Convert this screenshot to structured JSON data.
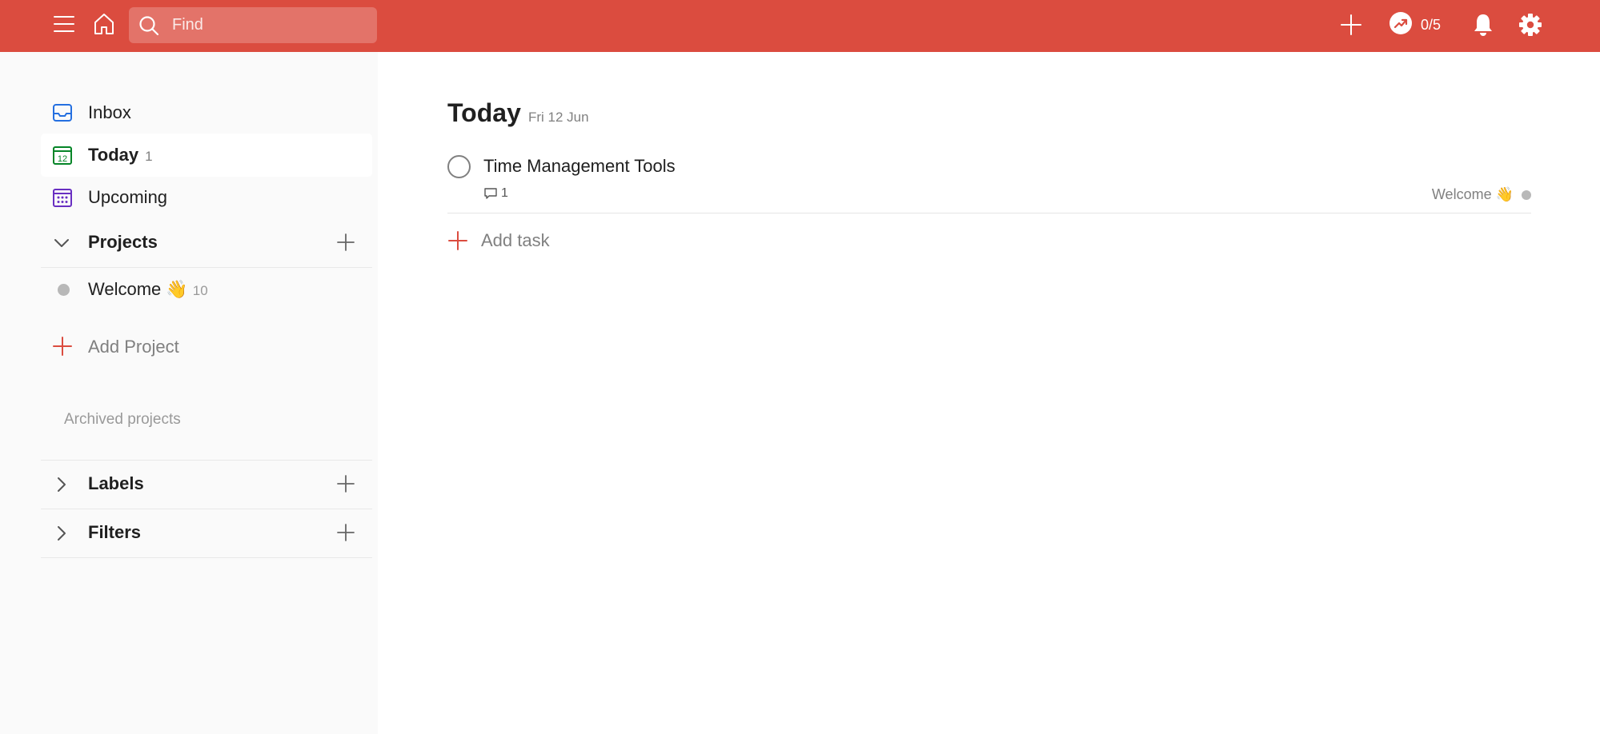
{
  "topbar": {
    "search": {
      "placeholder": "Find"
    },
    "karma": {
      "text": "0/5"
    }
  },
  "sidebar": {
    "nav": [
      {
        "label": "Inbox",
        "count": "",
        "icon": "inbox-icon",
        "color": "#246fe0"
      },
      {
        "label": "Today",
        "count": "1",
        "icon": "calendar-today-icon",
        "color": "#058527",
        "icon_text": "12"
      },
      {
        "label": "Upcoming",
        "count": "",
        "icon": "calendar-upcoming-icon",
        "color": "#692fc2"
      }
    ],
    "projects": {
      "label": "Projects",
      "items": [
        {
          "label": "Welcome 👋",
          "count": "10",
          "color": "#b8b8b8"
        }
      ],
      "add_label": "Add Project",
      "archived_label": "Archived projects"
    },
    "labels": {
      "label": "Labels"
    },
    "filters": {
      "label": "Filters"
    }
  },
  "main": {
    "title": "Today",
    "date": "Fri 12 Jun",
    "tasks": [
      {
        "title": "Time Management Tools",
        "comments": "1",
        "project": "Welcome 👋"
      }
    ],
    "add_task_label": "Add task"
  },
  "colors": {
    "brand": "#db4c3f",
    "sidebar_bg": "#fafafa",
    "muted": "#808080"
  }
}
